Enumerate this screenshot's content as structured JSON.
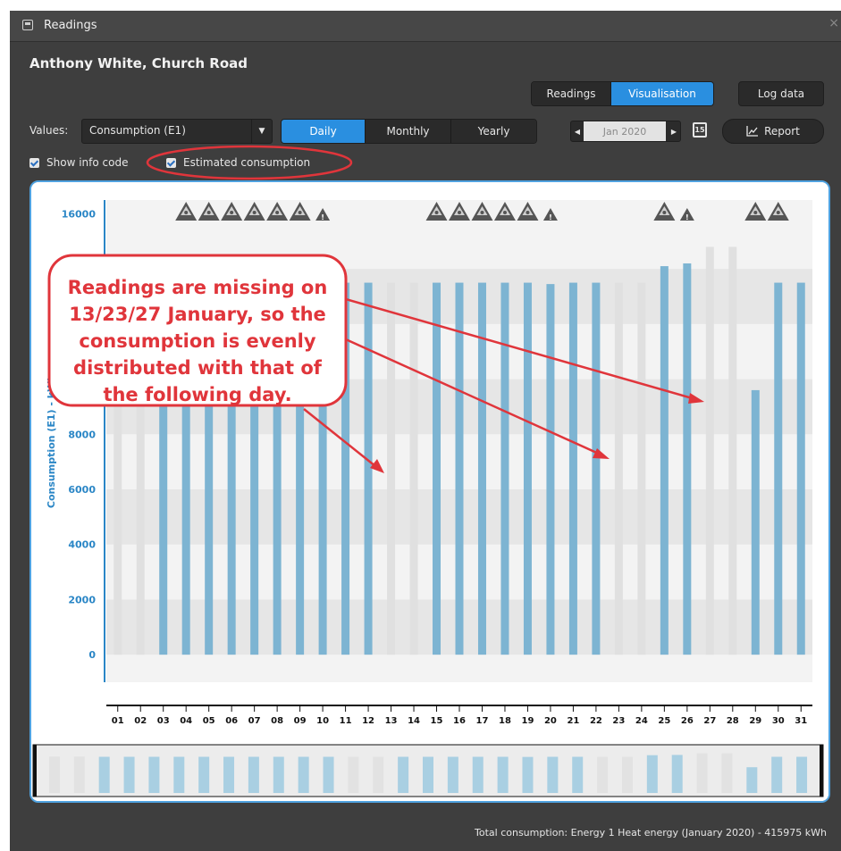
{
  "window": {
    "title": "Readings",
    "close_icon": "close-icon"
  },
  "customer_name": "Anthony White, Church Road",
  "view_tabs": [
    {
      "label": "Readings",
      "active": false
    },
    {
      "label": "Visualisation",
      "active": true
    }
  ],
  "log_data_label": "Log data",
  "values_label": "Values:",
  "values_select": "Consumption (E1)",
  "period_tabs": [
    {
      "label": "Daily",
      "active": true
    },
    {
      "label": "Monthly",
      "active": false
    },
    {
      "label": "Yearly",
      "active": false
    }
  ],
  "date_value": "Jan 2020",
  "calendar_icon_label": "15",
  "report_label": "Report",
  "checkboxes": [
    {
      "label": "Show info code",
      "checked": true
    },
    {
      "label": "Estimated consumption",
      "checked": true
    }
  ],
  "callout_text": "Readings are missing on 13/23/27 January, so the consumption is evenly distributed with that of the following day.",
  "callout_lines": [
    "Readings are missing on",
    "13/23/27 January, so the",
    "consumption is evenly",
    "distributed with that of",
    "the following day."
  ],
  "chart_data": {
    "type": "bar",
    "ylabel": "Consumption (E1) - kWh",
    "ylim": [
      -1000,
      16500
    ],
    "yticks": [
      0,
      2000,
      4000,
      6000,
      8000,
      16000
    ],
    "categories": [
      "01",
      "02",
      "03",
      "04",
      "05",
      "06",
      "07",
      "08",
      "09",
      "10",
      "11",
      "12",
      "13",
      "14",
      "15",
      "16",
      "17",
      "18",
      "19",
      "20",
      "21",
      "22",
      "23",
      "24",
      "25",
      "26",
      "27",
      "28",
      "29",
      "30",
      "31"
    ],
    "values": [
      13600,
      13600,
      13500,
      13500,
      13500,
      13500,
      13500,
      13500,
      13500,
      13500,
      13500,
      13500,
      13500,
      13500,
      13500,
      13500,
      13500,
      13500,
      13500,
      13450,
      13500,
      13500,
      13500,
      13500,
      14100,
      14200,
      14800,
      14800,
      9600,
      13500,
      13500
    ],
    "bar_states": [
      "g",
      "g",
      "b",
      "b",
      "b",
      "b",
      "b",
      "b",
      "b",
      "b",
      "b",
      "b",
      "g",
      "g",
      "b",
      "b",
      "b",
      "b",
      "b",
      "b",
      "b",
      "b",
      "g",
      "g",
      "b",
      "b",
      "g",
      "g",
      "b",
      "b",
      "b"
    ],
    "info_icons": [
      "",
      "",
      "",
      "seal",
      "seal",
      "seal",
      "seal",
      "seal",
      "seal",
      "warn",
      "",
      "",
      "",
      "",
      "seal",
      "seal",
      "seal",
      "seal",
      "seal",
      "warn",
      "",
      "",
      "",
      "",
      "seal",
      "warn",
      "",
      "",
      "seal",
      "seal",
      ""
    ],
    "colors": {
      "actual": "#7db4d2",
      "estimated": "#e0e0e0",
      "axis": "#2a86c6"
    }
  },
  "total_text": "Total consumption: Energy 1 Heat energy (January 2020) - 415975 kWh"
}
